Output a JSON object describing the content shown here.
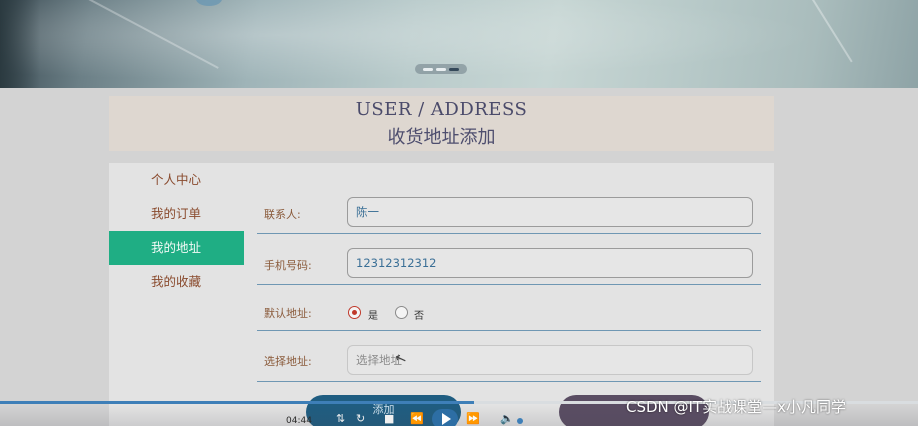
{
  "header": {
    "title_en": "USER / ADDRESS",
    "title_cn": "收货地址添加"
  },
  "sidebar": {
    "items": [
      {
        "label": "个人中心"
      },
      {
        "label": "我的订单"
      },
      {
        "label": "我的地址",
        "active": true
      },
      {
        "label": "我的收藏"
      }
    ]
  },
  "form": {
    "contact": {
      "label": "联系人:",
      "value": "陈一"
    },
    "phone": {
      "label": "手机号码:",
      "value": "12312312312"
    },
    "default_address": {
      "label": "默认地址:",
      "options": [
        "是",
        "否"
      ],
      "selected": "是"
    },
    "address": {
      "label": "选择地址:",
      "placeholder": "选择地址"
    },
    "submit_label": "添加"
  },
  "player": {
    "time": "04:44",
    "progress_fraction": 0.516
  },
  "watermark": "CSDN @IT实战课堂—x小凡同学",
  "colors": {
    "accent": "#1fae84",
    "link_text": "#8a4b2e",
    "divider": "#6f97b3",
    "radio_selected": "#c0392b"
  }
}
